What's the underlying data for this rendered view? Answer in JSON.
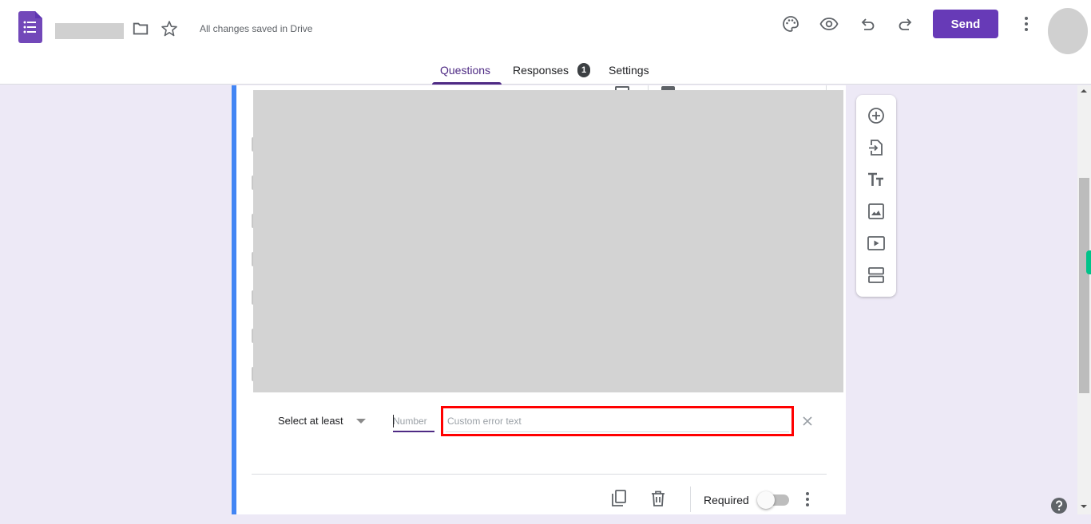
{
  "header": {
    "app_icon": "google-forms-icon",
    "title_redacted": true,
    "save_status": "All changes saved in Drive",
    "icons": [
      "folder-icon",
      "star-icon",
      "palette-icon",
      "eye-icon",
      "undo-icon",
      "redo-icon",
      "more-vert-icon"
    ],
    "send_label": "Send",
    "brand_color": "#673ab7"
  },
  "tabs": [
    {
      "label": "Questions",
      "active": true
    },
    {
      "label": "Responses",
      "badge": "1"
    },
    {
      "label": "Settings"
    }
  ],
  "question_card": {
    "content_redacted": true,
    "accent_color": "#4285f4",
    "validation": {
      "rule_select": "Select at least",
      "number_placeholder": "Number",
      "number_value": "",
      "error_placeholder": "Custom error text",
      "error_value": "",
      "highlight_color": "#ff0000"
    },
    "footer": {
      "required_label": "Required",
      "required_on": false
    }
  },
  "side_toolbar": [
    {
      "name": "add-question",
      "icon": "add-circle-icon"
    },
    {
      "name": "import-questions",
      "icon": "import-icon"
    },
    {
      "name": "add-title",
      "icon": "title-text-icon"
    },
    {
      "name": "add-image",
      "icon": "image-icon"
    },
    {
      "name": "add-video",
      "icon": "video-icon"
    },
    {
      "name": "add-section",
      "icon": "section-icon"
    }
  ],
  "help_icon": "help-icon"
}
